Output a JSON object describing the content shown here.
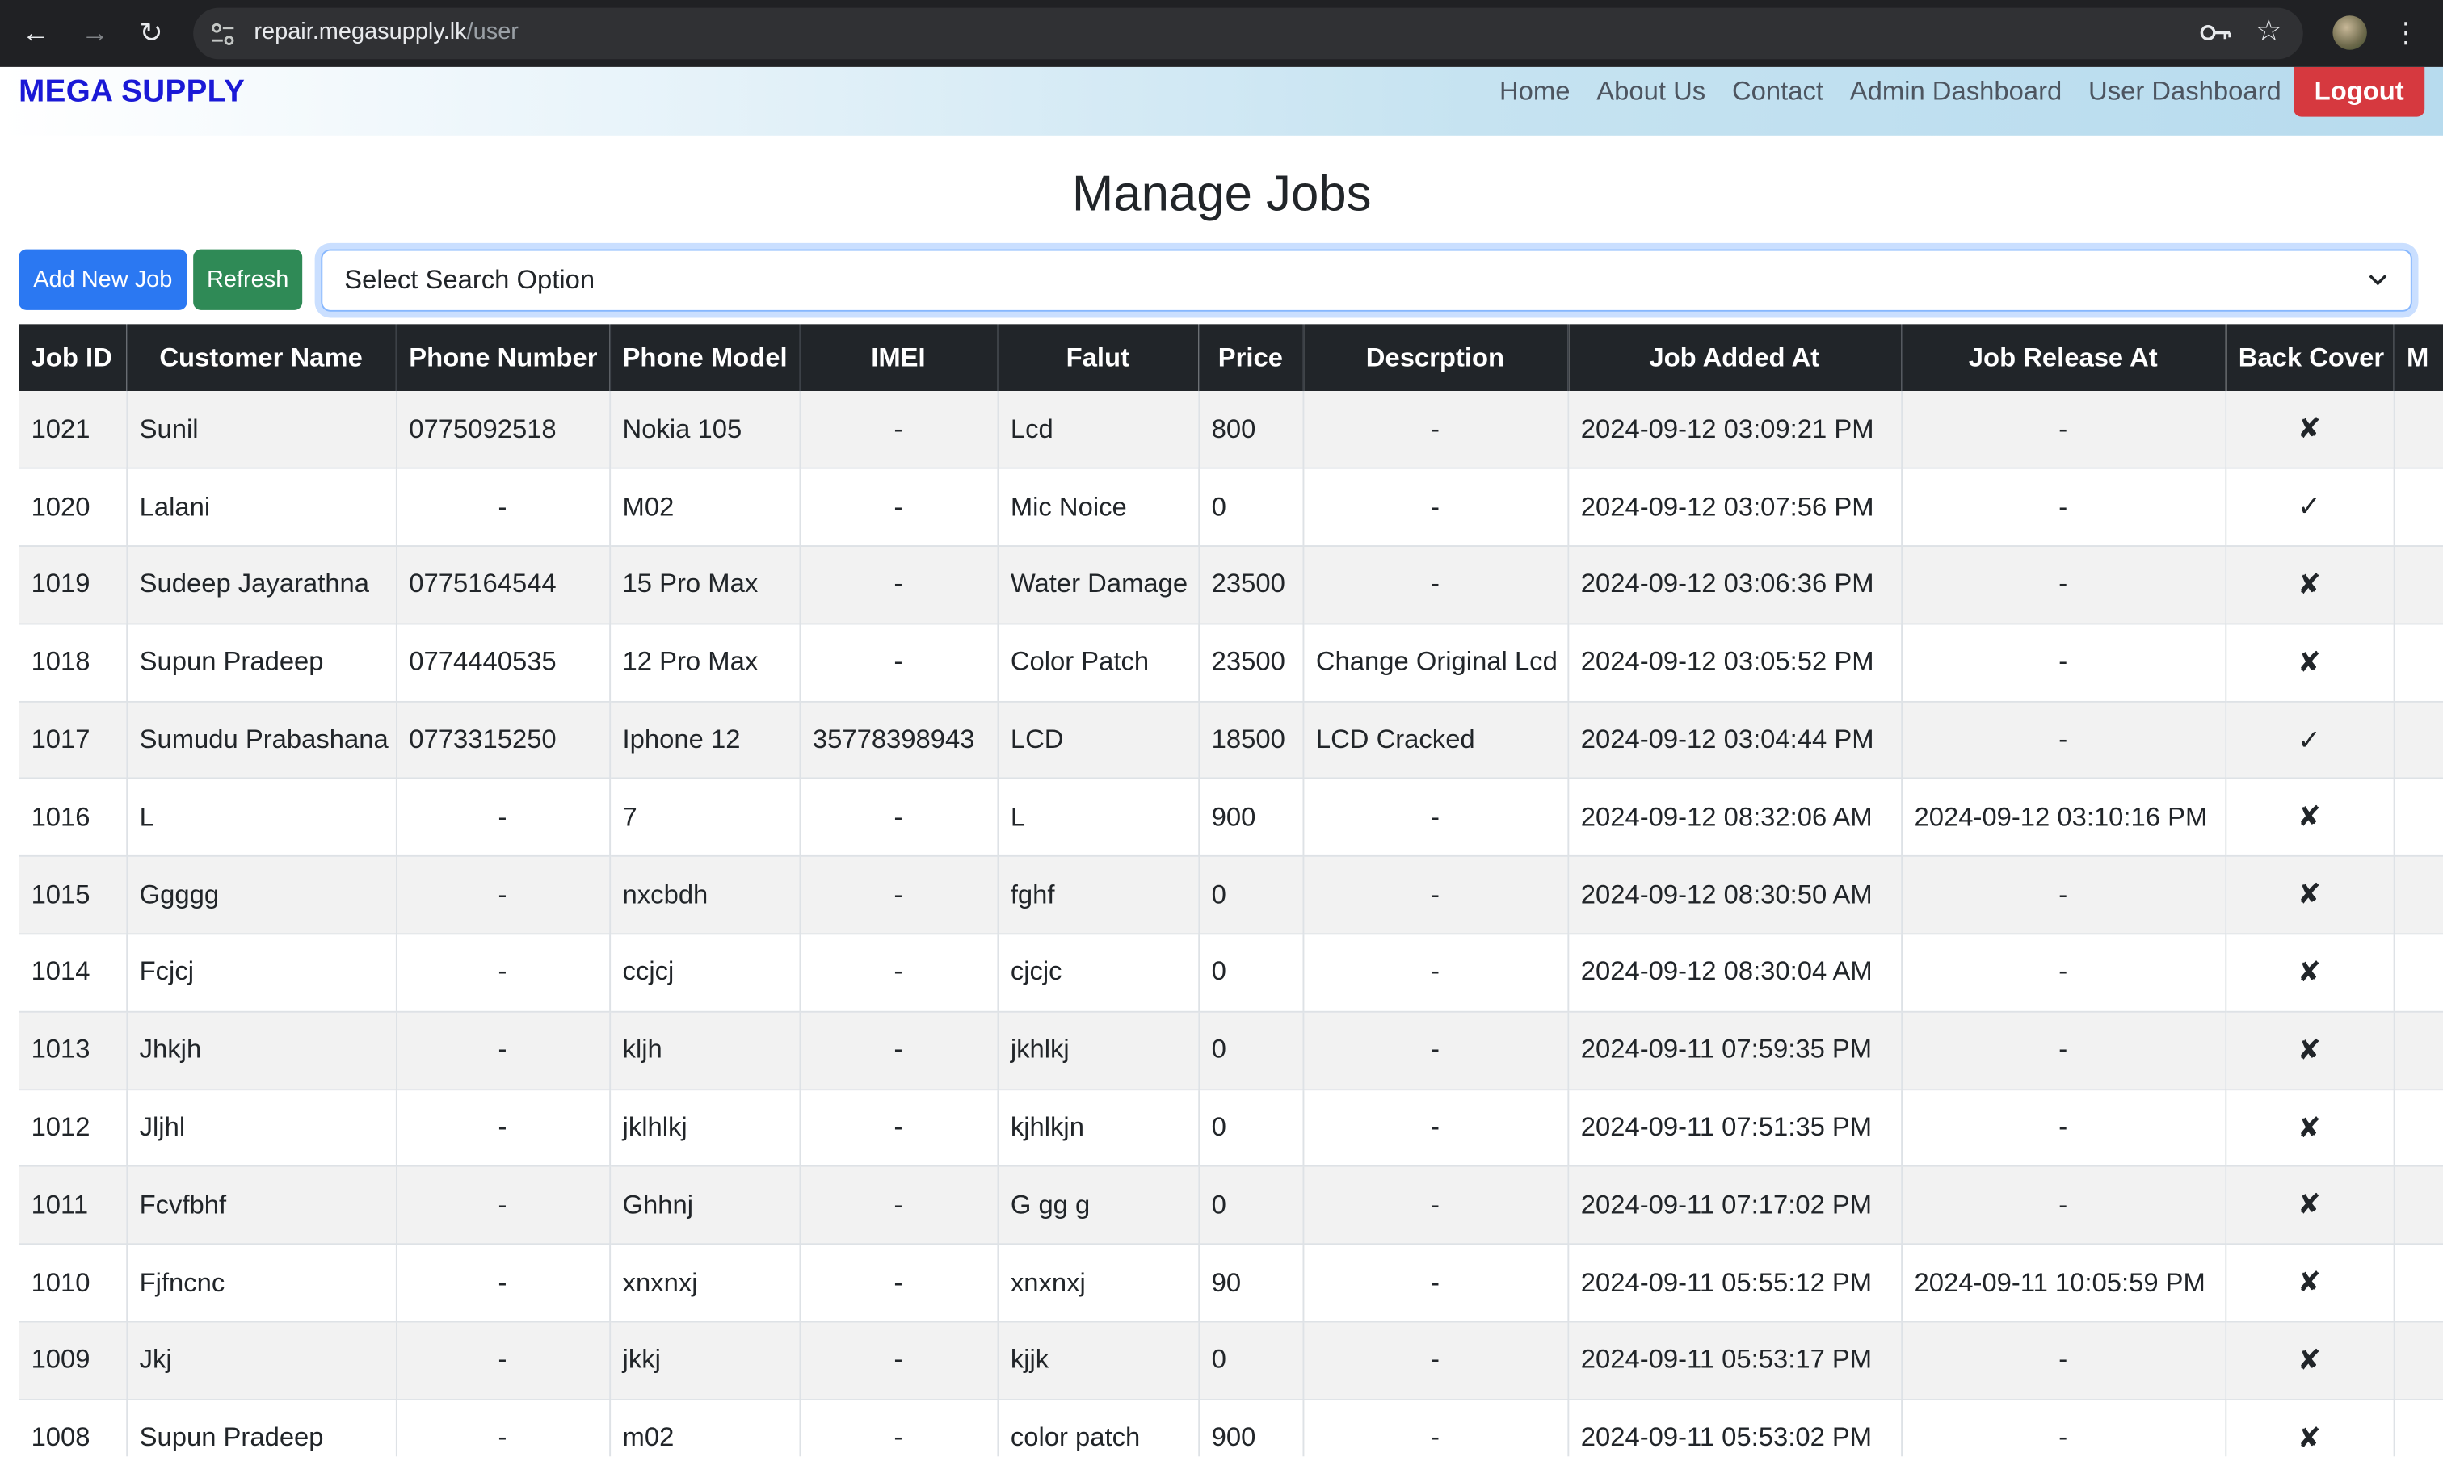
{
  "browser": {
    "url_host": "repair.megasupply.lk",
    "url_path": "/user"
  },
  "navbar": {
    "brand": "MEGA SUPPLY",
    "links": [
      "Home",
      "About Us",
      "Contact",
      "Admin Dashboard",
      "User Dashboard"
    ],
    "logout": "Logout"
  },
  "page": {
    "title": "Manage Jobs",
    "add_button": "Add New Job",
    "refresh_button": "Refresh",
    "search_select": "Select Search Option"
  },
  "table": {
    "headers": [
      "Job ID",
      "Customer Name",
      "Phone Number",
      "Phone Model",
      "IMEI",
      "Falut",
      "Price",
      "Descrption",
      "Job Added At",
      "Job Release At",
      "Back Cover",
      "M"
    ],
    "rows": [
      [
        "1021",
        "Sunil",
        "0775092518",
        "Nokia 105",
        "-",
        "Lcd",
        "800",
        "-",
        "2024-09-12 03:09:21 PM",
        "-",
        "✘",
        ""
      ],
      [
        "1020",
        "Lalani",
        "-",
        "M02",
        "-",
        "Mic Noice",
        "0",
        "-",
        "2024-09-12 03:07:56 PM",
        "-",
        "✓",
        ""
      ],
      [
        "1019",
        "Sudeep Jayarathna",
        "0775164544",
        "15 Pro Max",
        "-",
        "Water Damage",
        "23500",
        "-",
        "2024-09-12 03:06:36 PM",
        "-",
        "✘",
        ""
      ],
      [
        "1018",
        "Supun Pradeep",
        "0774440535",
        "12 Pro Max",
        "-",
        "Color Patch",
        "23500",
        "Change Original Lcd",
        "2024-09-12 03:05:52 PM",
        "-",
        "✘",
        ""
      ],
      [
        "1017",
        "Sumudu Prabashana",
        "0773315250",
        "Iphone 12",
        "35778398943",
        "LCD",
        "18500",
        "LCD Cracked",
        "2024-09-12 03:04:44 PM",
        "-",
        "✓",
        ""
      ],
      [
        "1016",
        "L",
        "-",
        "7",
        "-",
        "L",
        "900",
        "-",
        "2024-09-12 08:32:06 AM",
        "2024-09-12 03:10:16 PM",
        "✘",
        ""
      ],
      [
        "1015",
        "Ggggg",
        "-",
        "nxcbdh",
        "-",
        "fghf",
        "0",
        "-",
        "2024-09-12 08:30:50 AM",
        "-",
        "✘",
        ""
      ],
      [
        "1014",
        "Fcjcj",
        "-",
        "ccjcj",
        "-",
        "cjcjc",
        "0",
        "-",
        "2024-09-12 08:30:04 AM",
        "-",
        "✘",
        ""
      ],
      [
        "1013",
        "Jhkjh",
        "-",
        "kljh",
        "-",
        "jkhlkj",
        "0",
        "-",
        "2024-09-11 07:59:35 PM",
        "-",
        "✘",
        ""
      ],
      [
        "1012",
        "Jljhl",
        "-",
        "jklhlkj",
        "-",
        "kjhlkjn",
        "0",
        "-",
        "2024-09-11 07:51:35 PM",
        "-",
        "✘",
        ""
      ],
      [
        "1011",
        "Fcvfbhf",
        "-",
        "Ghhnj",
        "-",
        "G gg g",
        "0",
        "-",
        "2024-09-11 07:17:02 PM",
        "-",
        "✘",
        ""
      ],
      [
        "1010",
        "Fjfncnc",
        "-",
        "xnxnxj",
        "-",
        "xnxnxj",
        "90",
        "-",
        "2024-09-11 05:55:12 PM",
        "2024-09-11 10:05:59 PM",
        "✘",
        ""
      ],
      [
        "1009",
        "Jkj",
        "-",
        "jkkj",
        "-",
        "kjjk",
        "0",
        "-",
        "2024-09-11 05:53:17 PM",
        "-",
        "✘",
        ""
      ],
      [
        "1008",
        "Supun Pradeep",
        "-",
        "m02",
        "-",
        "color patch",
        "900",
        "-",
        "2024-09-11 05:53:02 PM",
        "-",
        "✘",
        ""
      ]
    ]
  }
}
